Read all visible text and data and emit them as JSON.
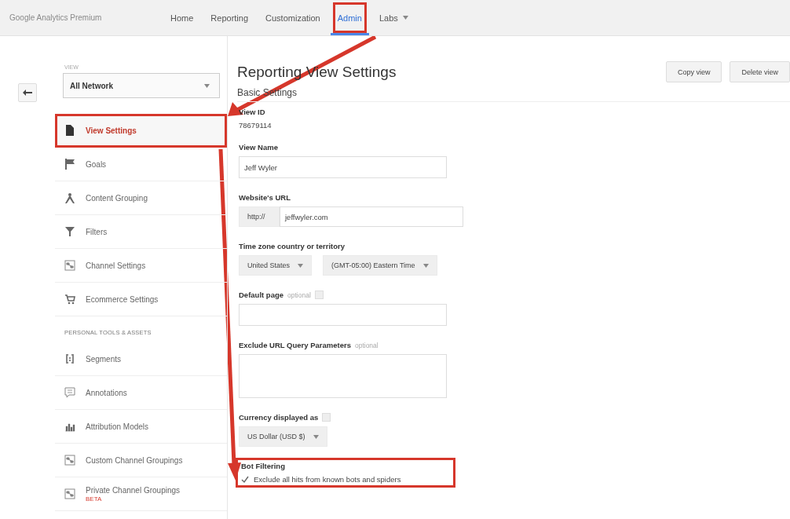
{
  "header": {
    "logo": "Google Analytics Premium",
    "tabs": [
      {
        "label": "Home",
        "selected": false,
        "highlighted": false,
        "has_menu": false
      },
      {
        "label": "Reporting",
        "selected": false,
        "highlighted": false,
        "has_menu": false
      },
      {
        "label": "Customization",
        "selected": false,
        "highlighted": false,
        "has_menu": false
      },
      {
        "label": "Admin",
        "selected": true,
        "highlighted": true,
        "has_menu": false
      },
      {
        "label": "Labs",
        "selected": false,
        "highlighted": false,
        "has_menu": true
      }
    ]
  },
  "sidebar": {
    "view_label": "VIEW",
    "view_select": "All Network",
    "items": [
      {
        "kind": "item",
        "label": "View Settings",
        "selected": true,
        "highlighted": true
      },
      {
        "kind": "item",
        "label": "Goals",
        "selected": false,
        "highlighted": false
      },
      {
        "kind": "item",
        "label": "Content Grouping",
        "selected": false,
        "highlighted": false
      },
      {
        "kind": "item",
        "label": "Filters",
        "selected": false,
        "highlighted": false
      },
      {
        "kind": "item",
        "label": "Channel Settings",
        "selected": false,
        "highlighted": false
      },
      {
        "kind": "item",
        "label": "Ecommerce Settings",
        "selected": false,
        "highlighted": false
      },
      {
        "kind": "heading",
        "label": "PERSONAL TOOLS & ASSETS"
      },
      {
        "kind": "item",
        "label": "Segments",
        "selected": false,
        "highlighted": false
      },
      {
        "kind": "item",
        "label": "Annotations",
        "selected": false,
        "highlighted": false
      },
      {
        "kind": "item",
        "label": "Attribution Models",
        "selected": false,
        "highlighted": false
      },
      {
        "kind": "item",
        "label": "Custom Channel Groupings",
        "selected": false,
        "highlighted": false
      },
      {
        "kind": "item",
        "label": "Private Channel Groupings",
        "badge": "BETA",
        "selected": false,
        "highlighted": false
      }
    ]
  },
  "main": {
    "title": "Reporting View Settings",
    "buttons": [
      "Copy view",
      "Delete view"
    ],
    "section": "Basic Settings",
    "fields": [
      {
        "kind": "readonly",
        "label": "View ID",
        "value": "78679114",
        "help": false,
        "highlighted": false
      },
      {
        "kind": "text",
        "label": "View Name",
        "value": "Jeff Wyler",
        "help": false,
        "highlighted": false
      },
      {
        "kind": "url",
        "label": "Website's URL",
        "protocol": "http://",
        "value": "jeffwyler.com",
        "help": false,
        "highlighted": false
      },
      {
        "kind": "selects",
        "label": "Time zone country or territory",
        "options": [
          "United States",
          "(GMT-05:00) Eastern Time"
        ],
        "help": false,
        "highlighted": false
      },
      {
        "kind": "text",
        "label": "Default page",
        "hint": "optional",
        "help": true,
        "highlighted": false
      },
      {
        "kind": "textarea",
        "label": "Exclude URL Query Parameters",
        "hint": "optional",
        "help": false,
        "highlighted": false
      },
      {
        "kind": "select",
        "label": "Currency displayed as",
        "value": "US Dollar (USD $)",
        "help": true,
        "highlighted": false
      },
      {
        "kind": "checkbox",
        "label": "Bot Filtering",
        "option": "Exclude all hits from known bots and spiders",
        "checked": true,
        "help": false,
        "highlighted": true
      }
    ]
  }
}
